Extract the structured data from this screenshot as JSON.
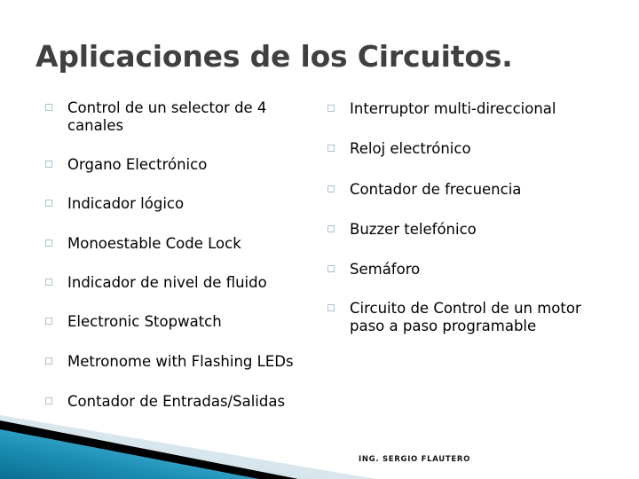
{
  "slide": {
    "title": "Aplicaciones de los Circuitos.",
    "background_color": "#ffffff",
    "title_color": "#404040",
    "body_text_color": "#000000",
    "bullet_marker_color": "#a8c4cc",
    "accent_teal_dark": "#0d7a9e",
    "accent_teal_light": "#55b8dd",
    "accent_black": "#000000",
    "accent_pale_blue": "#d9e6ec"
  },
  "columns": {
    "left": {
      "items": [
        {
          "text": "Control de un selector de 4 canales"
        },
        {
          "text": "Organo Electrónico"
        },
        {
          "text": "Indicador lógico"
        },
        {
          "text": "Monoestable Code Lock"
        },
        {
          "text": "Indicador de nivel de fluido"
        },
        {
          "text": "Electronic Stopwatch"
        },
        {
          "text": "Metronome with Flashing LEDs"
        },
        {
          "text": "Contador de Entradas/Salidas"
        }
      ]
    },
    "right": {
      "items": [
        {
          "text": "Interruptor multi-direccional"
        },
        {
          "text": "Reloj electrónico"
        },
        {
          "text": "Contador de frecuencia"
        },
        {
          "text": "Buzzer telefónico"
        },
        {
          "text": "Semáforo"
        },
        {
          "text": "Circuito de Control de un motor paso a paso programable"
        }
      ]
    }
  },
  "footer": {
    "text": "ING. SERGIO FLAUTERO"
  },
  "decoration": {
    "name": "diagonal-corner-band"
  }
}
